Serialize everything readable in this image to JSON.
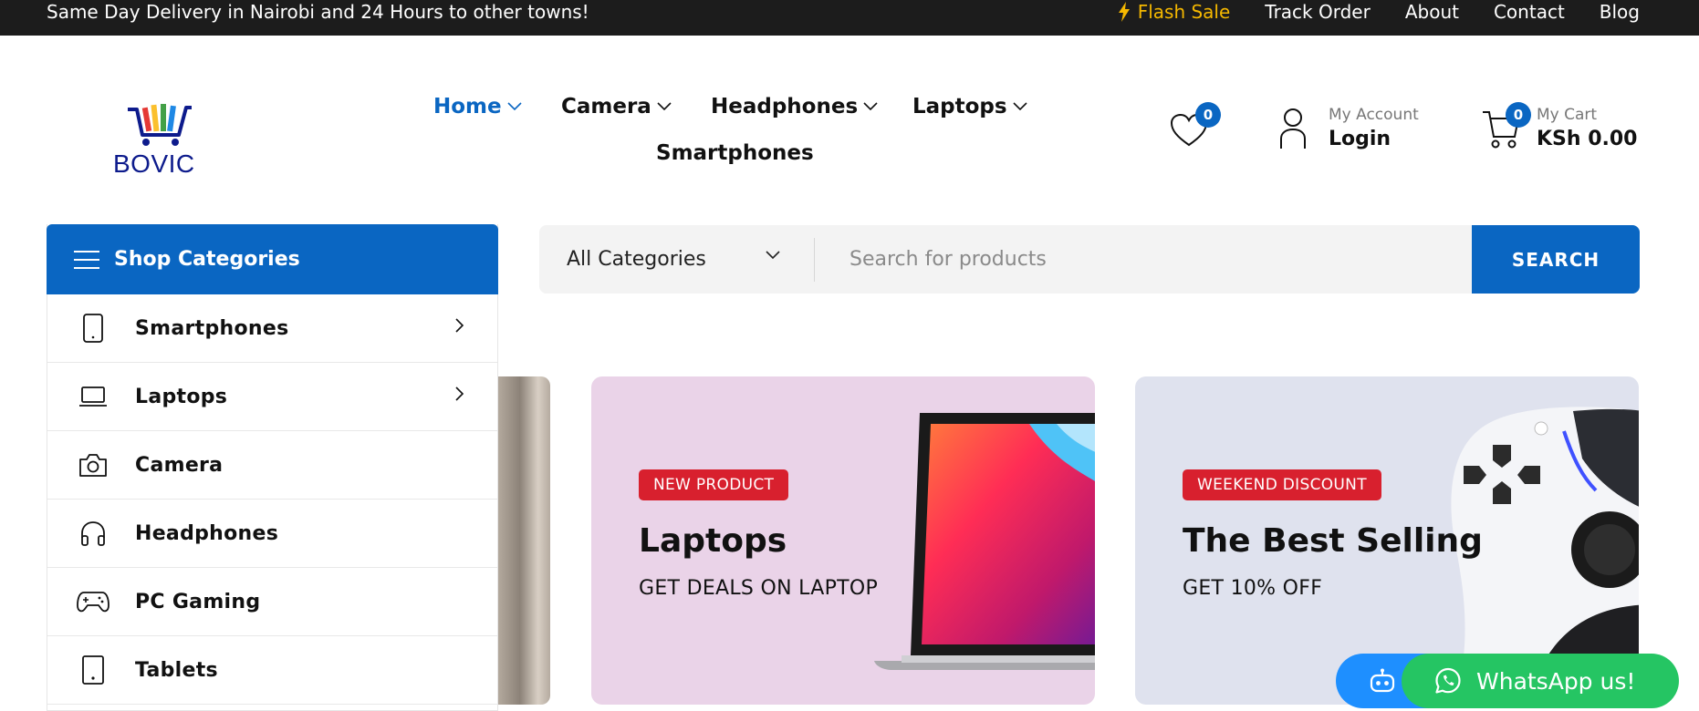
{
  "topbar": {
    "promo": "Same Day Delivery in Nairobi and 24 Hours to other towns!",
    "links": [
      "Flash Sale",
      "Track Order",
      "About",
      "Contact",
      "Blog"
    ]
  },
  "logo": {
    "text": "BOVIC"
  },
  "nav": [
    {
      "label": "Home",
      "active": true,
      "dropdown": true
    },
    {
      "label": "Camera",
      "dropdown": true
    },
    {
      "label": "Headphones",
      "dropdown": true
    },
    {
      "label": "Laptops",
      "dropdown": true
    },
    {
      "label": "Smartphones",
      "dropdown": false
    }
  ],
  "header": {
    "wishlist_count": "0",
    "account_small": "My Account",
    "account_big": "Login",
    "cart_count": "0",
    "cart_small": "My Cart",
    "cart_big": "KSh 0.00"
  },
  "categories": {
    "title": "Shop Categories",
    "items": [
      {
        "label": "Smartphones",
        "icon": "smartphone-icon",
        "has_sub": true
      },
      {
        "label": "Laptops",
        "icon": "laptop-icon",
        "has_sub": true
      },
      {
        "label": "Camera",
        "icon": "camera-icon",
        "has_sub": false
      },
      {
        "label": "Headphones",
        "icon": "headphones-icon",
        "has_sub": false
      },
      {
        "label": "PC Gaming",
        "icon": "gamepad-icon",
        "has_sub": false
      },
      {
        "label": "Tablets",
        "icon": "tablet-icon",
        "has_sub": false
      }
    ]
  },
  "search": {
    "category_selected": "All Categories",
    "placeholder": "Search for products",
    "button": "SEARCH"
  },
  "banners": [
    {
      "tag": "NEW PRODUCT",
      "title": "Laptops",
      "subtitle": "GET DEALS ON LAPTOP"
    },
    {
      "tag": "WEEKEND DISCOUNT",
      "title": "The Best Selling",
      "subtitle": "GET 10% OFF"
    }
  ],
  "whatsapp": {
    "label": "WhatsApp us!"
  },
  "colors": {
    "primary": "#0a66c2",
    "flash": "#f5b800",
    "tag": "#d8202e",
    "whatsapp": "#25c563",
    "topbar": "#1c1c1c"
  }
}
